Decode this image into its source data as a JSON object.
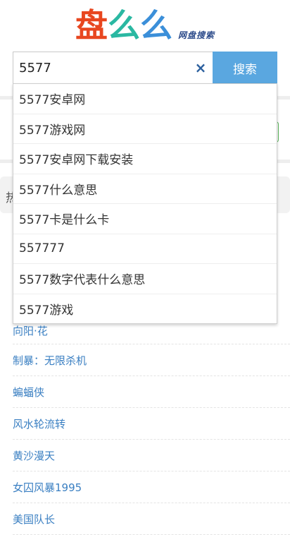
{
  "logo": {
    "chars": [
      {
        "text": "盘",
        "color": "#e8461f"
      },
      {
        "text": "么",
        "color": "#2ab8a2"
      },
      {
        "text": "么",
        "color": "#3b8fd9"
      }
    ],
    "subtitle": "网盘搜索"
  },
  "search": {
    "value": "5577",
    "clear_icon": "×",
    "button_label": "搜索"
  },
  "suggestions": [
    "5577安卓网",
    "5577游戏网",
    "5577安卓网下载安装",
    "5577什么意思",
    "5577卡是什么卡",
    "557777",
    "5577数字代表什么意思",
    "5577游戏"
  ],
  "hot": {
    "label_partial": "热",
    "items": [
      "向阳·花",
      "制暴：无限杀机",
      "蝙蝠侠",
      "风水轮流转",
      "黄沙漫天",
      "女囚风暴1995",
      "美国队长"
    ]
  }
}
